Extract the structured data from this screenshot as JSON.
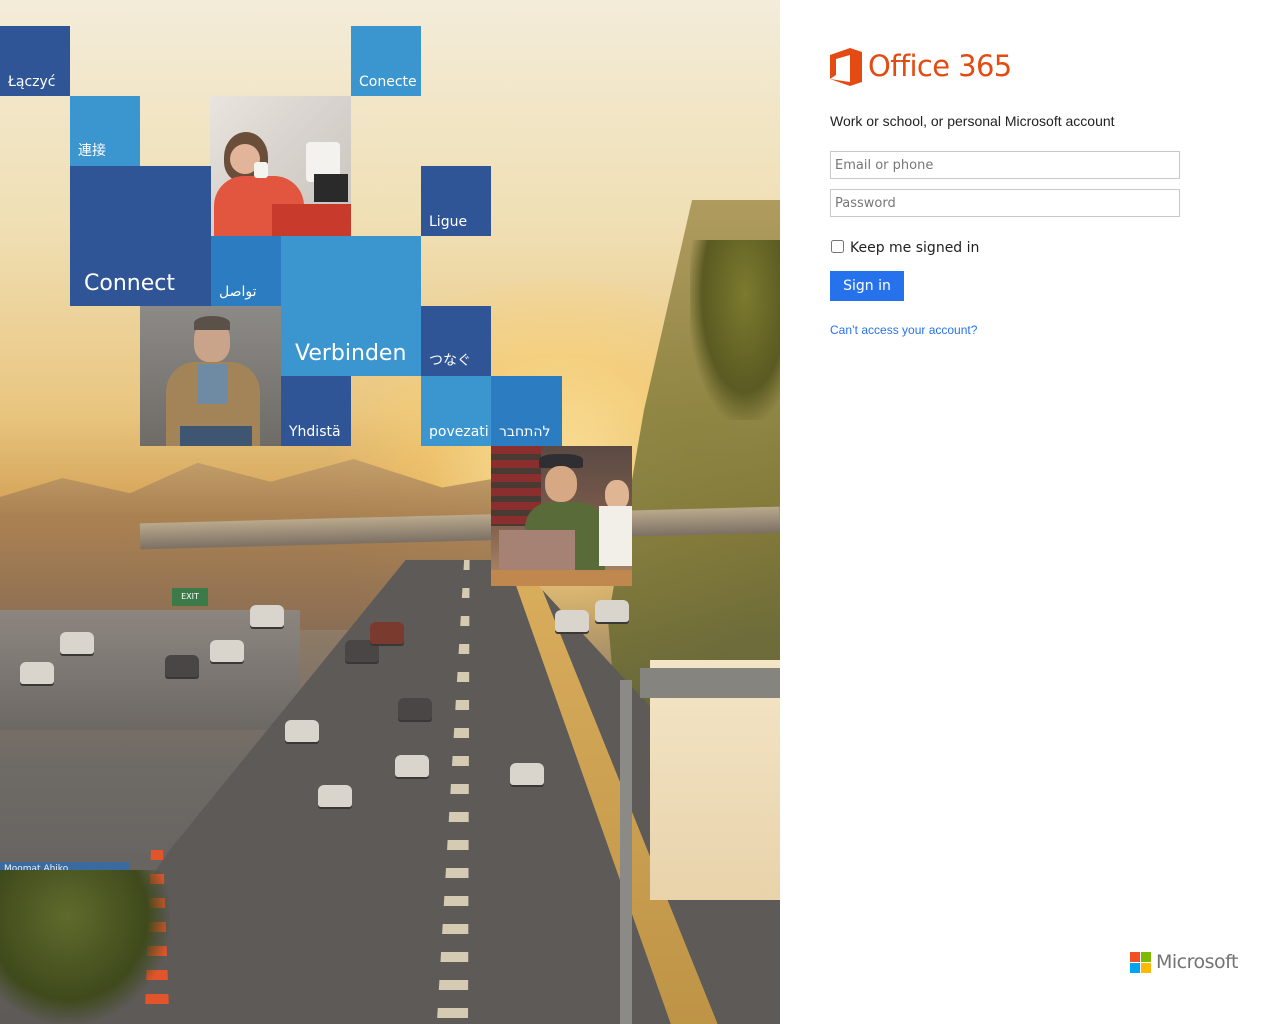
{
  "hero": {
    "tiles": [
      {
        "label": "Łączyć"
      },
      {
        "label": "Conecte"
      },
      {
        "label": "連接"
      },
      {
        "label": "Ligue"
      },
      {
        "label": "Connect"
      },
      {
        "label": "تواصل"
      },
      {
        "label": "Verbinden"
      },
      {
        "label": "つなぐ"
      },
      {
        "label": "Yhdistä"
      },
      {
        "label": "povezati"
      },
      {
        "label": "להתחבר"
      }
    ],
    "street_sign": "Moomat Ahiko",
    "exit_sign": "EXIT"
  },
  "brand": {
    "product_name": "Office 365",
    "company_name": "Microsoft",
    "office_color": "#e34b12",
    "accent_color": "#2672ec"
  },
  "login": {
    "subtitle": "Work or school, or personal Microsoft account",
    "email_placeholder": "Email or phone",
    "password_placeholder": "Password",
    "keep_signed_in_label": "Keep me signed in",
    "keep_signed_in_checked": false,
    "signin_label": "Sign in",
    "cant_access_label": "Can’t access your account?"
  },
  "icons": {
    "office_logo": "office-logo-icon",
    "microsoft_logo": "microsoft-logo-icon"
  }
}
